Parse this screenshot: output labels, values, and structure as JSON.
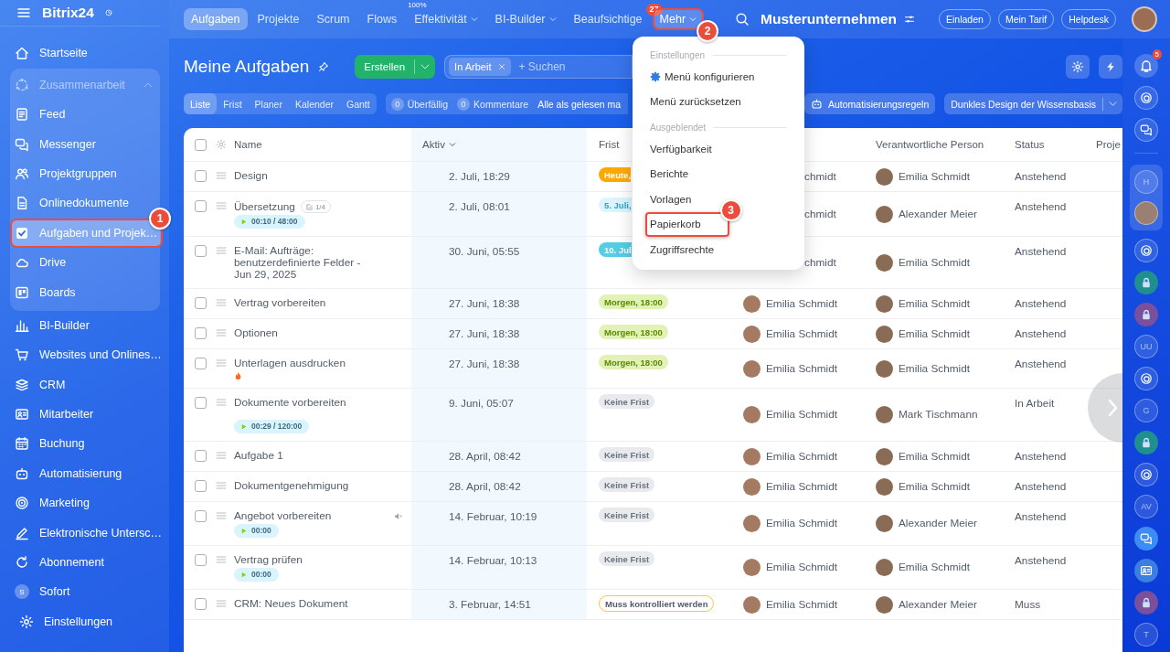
{
  "sidebar": {
    "logo": "Bitrix24",
    "items": [
      {
        "kind": "item",
        "label": "Startseite",
        "selected": false
      },
      {
        "kind": "group",
        "label": "Zusammenarbeit",
        "expanded": true,
        "children": [
          {
            "label": "Feed",
            "selected": false
          },
          {
            "label": "Messenger",
            "selected": false
          },
          {
            "label": "Projektgruppen",
            "selected": false
          },
          {
            "label": "Onlinedokumente",
            "selected": false
          },
          {
            "label": "Aufgaben und Projek…",
            "selected": true,
            "callout": "1"
          },
          {
            "label": "Drive",
            "selected": false
          },
          {
            "label": "Boards",
            "selected": false
          }
        ]
      },
      {
        "kind": "item",
        "label": "BI-Builder",
        "selected": false
      },
      {
        "kind": "item",
        "label": "Websites und Onlines…",
        "selected": false
      },
      {
        "kind": "item",
        "label": "CRM",
        "selected": false
      },
      {
        "kind": "item",
        "label": "Mitarbeiter",
        "selected": false
      },
      {
        "kind": "item",
        "label": "Buchung",
        "selected": false
      },
      {
        "kind": "item",
        "label": "Automatisierung",
        "selected": false
      },
      {
        "kind": "item",
        "label": "Marketing",
        "selected": false
      },
      {
        "kind": "item",
        "label": "Elektronische Untersc…",
        "selected": false
      },
      {
        "kind": "item",
        "label": "Abonnement",
        "selected": false
      },
      {
        "kind": "letter",
        "letter": "S",
        "label": "Sofort",
        "selected": false
      }
    ],
    "footer": "Einstellungen"
  },
  "topbar": {
    "tabs": [
      {
        "label": "Aufgaben",
        "selected": true
      },
      {
        "label": "Projekte",
        "selected": false
      },
      {
        "label": "Scrum",
        "selected": false
      },
      {
        "label": "Flows",
        "selected": false
      },
      {
        "label": "Effektivität",
        "selected": false,
        "dropdown": true,
        "note": "100%"
      },
      {
        "label": "BI-Builder",
        "selected": false,
        "dropdown": true
      },
      {
        "label": "Beaufsichtige",
        "selected": false,
        "badge": "27"
      },
      {
        "label": "Mehr",
        "selected": false,
        "dropdown": true,
        "open": true,
        "callout": "2"
      }
    ],
    "company": "Musterunternehmen",
    "buttons": [
      "Einladen",
      "Mein Tarif",
      "Helpdesk"
    ]
  },
  "header": {
    "title": "Meine Aufgaben",
    "create_button": "Erstellen",
    "filter": {
      "chip": "In Arbeit",
      "placeholder": "+ Suchen"
    }
  },
  "toolbar": {
    "views": [
      {
        "label": "Liste",
        "selected": true
      },
      {
        "label": "Frist",
        "selected": false
      },
      {
        "label": "Planer",
        "selected": false
      },
      {
        "label": "Kalender",
        "selected": false
      },
      {
        "label": "Gantt",
        "selected": false
      }
    ],
    "counters": [
      {
        "count": "0",
        "label": "Überfällig"
      },
      {
        "count": "0",
        "label": "Kommentare"
      }
    ],
    "mark_read": "Alle als gelesen ma",
    "automation_button": "Automatisierungsregeln",
    "kb_select": "Dunkles Design der Wissensbasis"
  },
  "table": {
    "select_all_checked": false,
    "columns": [
      {
        "label": "Name"
      },
      {
        "label": "Aktiv",
        "sorted": true
      },
      {
        "label": "Frist"
      },
      {
        "label": "Verantwortliche Person"
      },
      {
        "label": "Status"
      },
      {
        "label": "Proje"
      }
    ],
    "rows": [
      {
        "checked": false,
        "name": "Design",
        "active": "2. Juli, 18:29",
        "deadline": {
          "text": "Heute,",
          "kind": "today",
          "cut": true
        },
        "column_4": {
          "text": "chmidt",
          "cut": true
        },
        "responsible": "Emilia Schmidt",
        "status": "Anstehend"
      },
      {
        "checked": false,
        "name": "Übersetzung",
        "checklist": "1/4",
        "timer": "00:10 / 48:00",
        "active": "2. Juli, 08:01",
        "deadline": {
          "text": "5. Juli,",
          "kind": "soon",
          "cut": true
        },
        "column_4": {
          "text": "chmidt",
          "cut": true
        },
        "responsible": "Alexander Meier",
        "status": "Anstehend"
      },
      {
        "checked": false,
        "name": "E-Mail: Aufträge: benutzerdefinierte Felder - Jun 29, 2025",
        "active": "30. Juni, 05:55",
        "deadline": {
          "text": "10. Jul",
          "kind": "week",
          "cut": true
        },
        "column_4": {
          "text": "chmidt",
          "cut": true
        },
        "responsible": "Emilia Schmidt",
        "status": "Anstehend"
      },
      {
        "checked": false,
        "name": "Vertrag vorbereiten",
        "active": "27. Juni, 18:38",
        "deadline": {
          "text": "Morgen, 18:00",
          "kind": "tomorrow"
        },
        "column_4": {
          "text": "Emilia Schmidt"
        },
        "responsible": "Emilia Schmidt",
        "status": "Anstehend"
      },
      {
        "checked": false,
        "name": "Optionen",
        "active": "27. Juni, 18:38",
        "deadline": {
          "text": "Morgen, 18:00",
          "kind": "tomorrow"
        },
        "column_4": {
          "text": "Emilia Schmidt"
        },
        "responsible": "Emilia Schmidt",
        "status": "Anstehend"
      },
      {
        "checked": false,
        "name": "Unterlagen ausdrucken",
        "hot": true,
        "active": "27. Juni, 18:38",
        "deadline": {
          "text": "Morgen, 18:00",
          "kind": "tomorrow"
        },
        "column_4": {
          "text": "Emilia Schmidt"
        },
        "responsible": "Emilia Schmidt",
        "status": "Anstehend"
      },
      {
        "checked": false,
        "name": "Dokumente vorbereiten",
        "timer": "00:29 / 120:00",
        "active": "9. Juni, 05:07",
        "deadline": {
          "text": "Keine Frist",
          "kind": "none"
        },
        "column_4": {
          "text": "Emilia Schmidt"
        },
        "responsible": "Mark Tischmann",
        "status": "In Arbeit"
      },
      {
        "checked": false,
        "name": "Aufgabe 1",
        "active": "28. April, 08:42",
        "deadline": {
          "text": "Keine Frist",
          "kind": "none"
        },
        "column_4": {
          "text": "Emilia Schmidt"
        },
        "responsible": "Emilia Schmidt",
        "status": "Anstehend"
      },
      {
        "checked": false,
        "name": "Dokumentgenehmigung",
        "active": "28. April, 08:42",
        "deadline": {
          "text": "Keine Frist",
          "kind": "none"
        },
        "column_4": {
          "text": "Emilia Schmidt"
        },
        "responsible": "Emilia Schmidt",
        "status": "Anstehend"
      },
      {
        "checked": false,
        "name": "Angebot vorbereiten",
        "muted": true,
        "timer": "00:00",
        "active": "14. Februar, 10:19",
        "deadline": {
          "text": "Keine Frist",
          "kind": "none"
        },
        "column_4": {
          "text": "Emilia Schmidt"
        },
        "responsible": "Alexander Meier",
        "status": "Anstehend"
      },
      {
        "checked": false,
        "name": "Vertrag prüfen",
        "timer": "00:00",
        "active": "14. Februar, 10:13",
        "deadline": {
          "text": "Keine Frist",
          "kind": "none"
        },
        "column_4": {
          "text": "Emilia Schmidt"
        },
        "responsible": "Emilia Schmidt",
        "status": "Anstehend"
      },
      {
        "checked": false,
        "name": "CRM: Neues Dokument",
        "active": "3. Februar, 14:51",
        "deadline": {
          "text": "Muss kontrolliert werden",
          "kind": "review"
        },
        "column_4": {
          "text": "Emilia Schmidt"
        },
        "responsible": "Alexander Meier",
        "status": "Muss"
      }
    ]
  },
  "menu": {
    "sections": [
      {
        "title": "Einstellungen",
        "items": [
          {
            "label": "Menü konfigurieren",
            "kind": "gear",
            "selected": false
          },
          {
            "label": "Menü zurücksetzen",
            "kind": "plain",
            "selected": false
          }
        ]
      },
      {
        "title": "Ausgeblendet",
        "items": [
          {
            "label": "Verfügbarkeit",
            "kind": "plain",
            "selected": false
          },
          {
            "label": "Berichte",
            "kind": "plain",
            "selected": false
          },
          {
            "label": "Vorlagen",
            "kind": "plain",
            "selected": false
          },
          {
            "label": "Papierkorb",
            "kind": "plain",
            "selected": true,
            "callout": "3"
          },
          {
            "label": "Zugriffsrechte",
            "kind": "plain",
            "selected": false
          }
        ]
      }
    ]
  },
  "right_bar": {
    "bell_badge": "5",
    "items": [
      {
        "kind": "swirl"
      },
      {
        "kind": "chat-plus"
      },
      {
        "kind": "letter",
        "text": "H",
        "group": true
      },
      {
        "kind": "avatar",
        "group": true
      },
      {
        "kind": "swirl"
      },
      {
        "kind": "lock",
        "color": "#1f8f8f"
      },
      {
        "kind": "lock",
        "color": "#7a4f9c"
      },
      {
        "kind": "letter",
        "text": "UU"
      },
      {
        "kind": "swirl"
      },
      {
        "kind": "letter",
        "text": "G"
      },
      {
        "kind": "lock",
        "color": "#1f8f8f"
      },
      {
        "kind": "swirl"
      },
      {
        "kind": "letter",
        "text": "AV"
      },
      {
        "kind": "chat"
      },
      {
        "kind": "card"
      },
      {
        "kind": "lock",
        "color": "#7a4f9c"
      },
      {
        "kind": "letter",
        "text": "T"
      }
    ]
  }
}
